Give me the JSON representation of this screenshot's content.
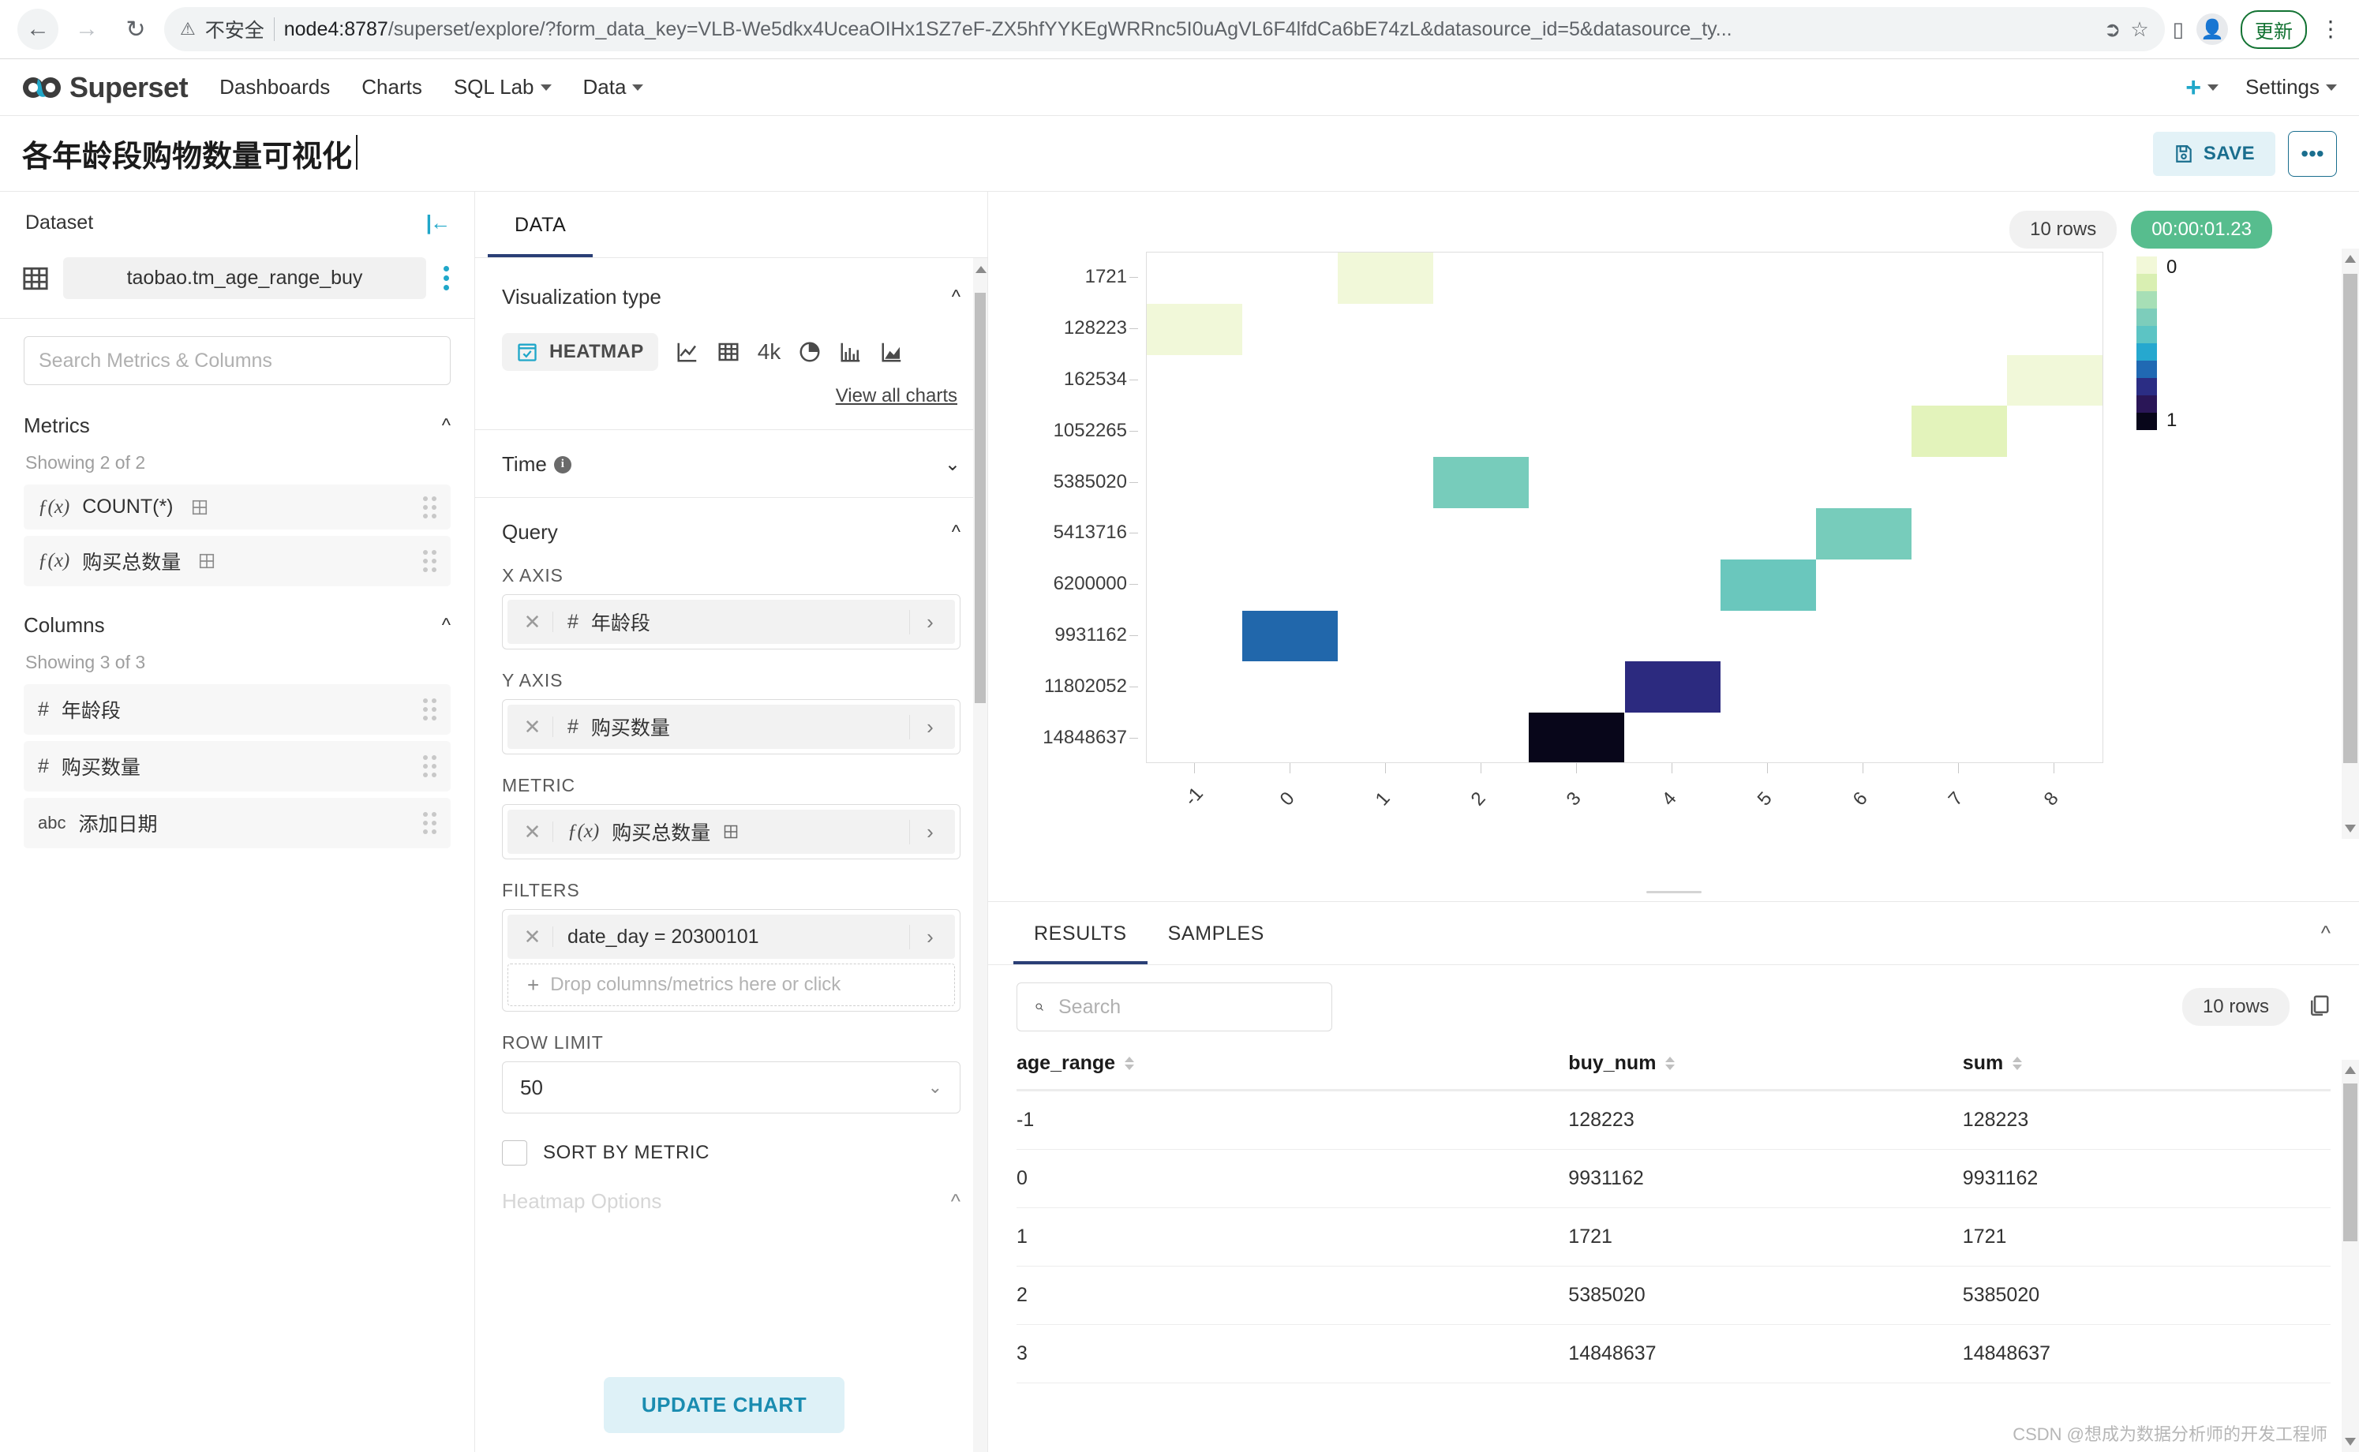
{
  "browser": {
    "not_secure_label": "不安全",
    "url_host": "node4:8787",
    "url_rest": "/superset/explore/?form_data_key=VLB-We5dkx4UceaOIHx1SZ7eF-ZX5hfYYKEgWRRnc5I0uAgVL6F4lfdCa6bE74zL&datasource_id=5&datasource_ty...",
    "update_button": "更新",
    "icons": {
      "back": "back-arrow-icon",
      "forward": "forward-arrow-icon",
      "reload": "reload-icon",
      "share": "share-icon",
      "bookmark": "star-icon",
      "extension": "extension-icon",
      "profile": "profile-avatar-icon",
      "menu": "chrome-menu-icon"
    }
  },
  "nav": {
    "brand": "Superset",
    "links": [
      {
        "label": "Dashboards",
        "has_caret": false
      },
      {
        "label": "Charts",
        "has_caret": false
      },
      {
        "label": "SQL Lab",
        "has_caret": true
      },
      {
        "label": "Data",
        "has_caret": true
      }
    ],
    "settings_label": "Settings"
  },
  "header": {
    "chart_title": "各年龄段购物数量可视化",
    "save_label": "SAVE",
    "more_label": "•••"
  },
  "left_panel": {
    "dataset_label": "Dataset",
    "dataset_name": "taobao.tm_age_range_buy",
    "search_placeholder": "Search Metrics & Columns",
    "search_value": "",
    "metrics_header": "Metrics",
    "metrics_showing": "Showing 2 of 2",
    "metrics": [
      {
        "type": "fx",
        "label": "COUNT(*)",
        "has_calc": true
      },
      {
        "type": "fx",
        "label": "购买总数量",
        "has_calc": true
      }
    ],
    "columns_header": "Columns",
    "columns_showing": "Showing 3 of 3",
    "columns": [
      {
        "type": "#",
        "label": "年龄段"
      },
      {
        "type": "#",
        "label": "购买数量"
      },
      {
        "type": "abc",
        "label": "添加日期"
      }
    ]
  },
  "control_panel": {
    "tabs": [
      {
        "label": "DATA",
        "active": true
      }
    ],
    "viz_type_header": "Visualization type",
    "viz_selected": "HEATMAP",
    "viz_alternatives": [
      "line-chart-icon",
      "table-icon",
      "big-number-4k-icon",
      "pie-chart-icon",
      "bar-chart-icon",
      "area-chart-icon"
    ],
    "view_all_charts": "View all charts",
    "time_header": "Time",
    "query_header": "Query",
    "x_axis_label": "X AXIS",
    "x_axis_value": "年龄段",
    "y_axis_label": "Y AXIS",
    "y_axis_value": "购买数量",
    "metric_label": "METRIC",
    "metric_value": "购买总数量",
    "filters_label": "FILTERS",
    "filter_value": "date_day = 20300101",
    "filter_dropzone": "Drop columns/metrics here or click",
    "row_limit_label": "ROW LIMIT",
    "row_limit_value": "50",
    "sort_by_metric_label": "SORT BY METRIC",
    "sort_by_metric_checked": false,
    "heatmap_options_header": "Heatmap Options",
    "update_chart_label": "UPDATE CHART"
  },
  "chart_header": {
    "rows_badge": "10 rows",
    "time_badge": "00:00:01.23"
  },
  "chart_data": {
    "type": "heatmap",
    "title": "各年龄段购物数量可视化",
    "xlabel": "年龄段",
    "ylabel": "购买数量",
    "metric": "购买总数量",
    "x_categories": [
      "-1",
      "0",
      "1",
      "2",
      "3",
      "4",
      "5",
      "6",
      "7",
      "8"
    ],
    "y_categories": [
      "1721",
      "128223",
      "162534",
      "1052265",
      "5385020",
      "5413716",
      "6200000",
      "9931162",
      "11802052",
      "14848637"
    ],
    "legend": {
      "position": "right",
      "min_label": "0",
      "max_label": "1"
    },
    "color_scale": [
      "#f2f8d8",
      "#d9efb2",
      "#a7dfb6",
      "#7dcdbb",
      "#5cc4c4",
      "#26a8cf",
      "#2069b3",
      "#2b2d84",
      "#2a1657",
      "#08061a"
    ],
    "cells": [
      {
        "x": "1",
        "y": "1721",
        "value": 1721,
        "normalized": 0.0,
        "color": "#f1f8d9"
      },
      {
        "x": "-1",
        "y": "128223",
        "value": 128223,
        "normalized": 0.01,
        "color": "#f1f8d9"
      },
      {
        "x": "8",
        "y": "162534",
        "value": 162534,
        "normalized": 0.01,
        "color": "#f1f8d9"
      },
      {
        "x": "7",
        "y": "1052265",
        "value": 1052265,
        "normalized": 0.07,
        "color": "#e3f3bb"
      },
      {
        "x": "2",
        "y": "5385020",
        "value": 5385020,
        "normalized": 0.36,
        "color": "#77ccbb"
      },
      {
        "x": "6",
        "y": "5413716",
        "value": 5413716,
        "normalized": 0.36,
        "color": "#77ccbb"
      },
      {
        "x": "5",
        "y": "6200000",
        "value": 6200000,
        "normalized": 0.42,
        "color": "#6ac7bd"
      },
      {
        "x": "0",
        "y": "9931162",
        "value": 9931162,
        "normalized": 0.67,
        "color": "#2167ab"
      },
      {
        "x": "4",
        "y": "11802052",
        "value": 11802052,
        "normalized": 0.79,
        "color": "#2c2a7f"
      },
      {
        "x": "3",
        "y": "14848637",
        "value": 14848637,
        "normalized": 1.0,
        "color": "#08061a"
      }
    ]
  },
  "results": {
    "tabs": [
      {
        "label": "RESULTS",
        "active": true
      },
      {
        "label": "SAMPLES",
        "active": false
      }
    ],
    "search_placeholder": "Search",
    "search_value": "",
    "rows_badge": "10 rows",
    "columns": [
      "age_range",
      "buy_num",
      "sum"
    ],
    "rows": [
      [
        "-1",
        "128223",
        "128223"
      ],
      [
        "0",
        "9931162",
        "9931162"
      ],
      [
        "1",
        "1721",
        "1721"
      ],
      [
        "2",
        "5385020",
        "5385020"
      ],
      [
        "3",
        "14848637",
        "14848637"
      ]
    ]
  },
  "watermark": "CSDN @想成为数据分析师的开发工程师",
  "colors": {
    "accent_cyan": "#20a7c9",
    "tab_indigo": "#2a3f76",
    "save_teal": "#1a6e8e",
    "time_green": "#57bd8e"
  }
}
